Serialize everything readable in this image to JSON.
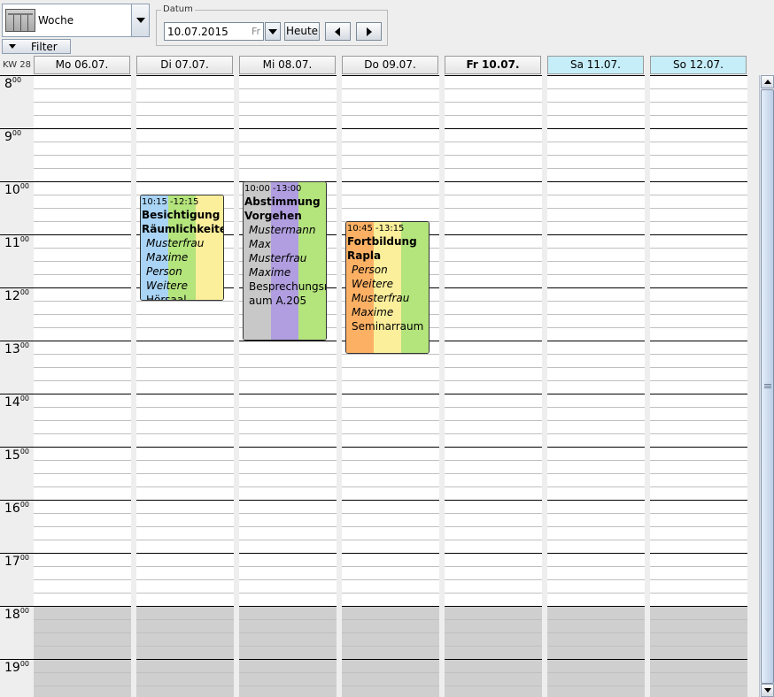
{
  "toolbar": {
    "view_label": "Woche",
    "filter_label": "Filter",
    "datum_legend": "Datum",
    "date_value": "10.07.2015",
    "date_weekday": "Fr",
    "today_label": "Heute"
  },
  "week_label": "KW 28",
  "days": [
    {
      "label": "Mo 06.07.",
      "today": false,
      "weekend": false
    },
    {
      "label": "Di 07.07.",
      "today": false,
      "weekend": false
    },
    {
      "label": "Mi 08.07.",
      "today": false,
      "weekend": false
    },
    {
      "label": "Do 09.07.",
      "today": false,
      "weekend": false
    },
    {
      "label": "Fr 10.07.",
      "today": true,
      "weekend": false
    },
    {
      "label": "Sa 11.07.",
      "today": false,
      "weekend": true
    },
    {
      "label": "So 12.07.",
      "today": false,
      "weekend": true
    }
  ],
  "hours": [
    {
      "h": "8",
      "m": "00"
    },
    {
      "h": "9",
      "m": "00"
    },
    {
      "h": "10",
      "m": "00"
    },
    {
      "h": "11",
      "m": "00"
    },
    {
      "h": "12",
      "m": "00"
    },
    {
      "h": "13",
      "m": "00"
    },
    {
      "h": "14",
      "m": "00"
    },
    {
      "h": "15",
      "m": "00"
    },
    {
      "h": "16",
      "m": "00"
    },
    {
      "h": "17",
      "m": "00"
    },
    {
      "h": "18",
      "m": "00"
    },
    {
      "h": "19",
      "m": "00"
    }
  ],
  "appointments": [
    {
      "day_index": 1,
      "time": "10:15 -12:15",
      "title_lines": [
        "Besichtigung",
        "Räumlichkeiten"
      ],
      "persons": [
        "Musterfrau",
        "Maxime",
        "Person Weitere"
      ],
      "room_lines": [
        "Hörsaal"
      ],
      "colors": [
        "#a9d4f5",
        "#b4e47c",
        "#fbef9b"
      ]
    },
    {
      "day_index": 2,
      "time": "10:00 -13:00",
      "title_lines": [
        "Abstimmung",
        "Vorgehen"
      ],
      "persons": [
        "Mustermann",
        "Max",
        "Musterfrau",
        "Maxime"
      ],
      "room_lines": [
        "Besprechungsr",
        "aum A.205"
      ],
      "colors": [
        "#c8c8c8",
        "#b09ee0",
        "#b4e47c"
      ]
    },
    {
      "day_index": 3,
      "time": "10:45 -13:15",
      "title_lines": [
        "Fortbildung",
        "Rapla"
      ],
      "persons": [
        "Person Weitere",
        "Musterfrau",
        "Maxime"
      ],
      "room_lines": [
        "Seminarraum"
      ],
      "colors": [
        "#fcb064",
        "#fbef9b",
        "#b4e47c"
      ]
    }
  ]
}
